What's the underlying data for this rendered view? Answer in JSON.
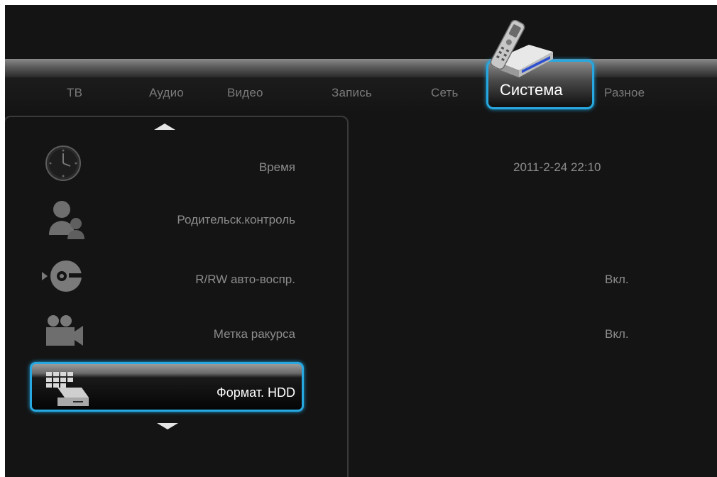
{
  "tabs": [
    {
      "label": "ТВ"
    },
    {
      "label": "Аудио"
    },
    {
      "label": "Видео"
    },
    {
      "label": "Запись"
    },
    {
      "label": "Сеть"
    },
    {
      "label": "Система"
    },
    {
      "label": "Разное"
    }
  ],
  "active_tab": "Система",
  "menu": {
    "items": [
      {
        "label": "Время",
        "icon": "clock-icon",
        "value": "2011-2-24 22:10"
      },
      {
        "label": "Родительск.контроль",
        "icon": "parental-control-icon",
        "value": ""
      },
      {
        "label": "R/RW авто-воспр.",
        "icon": "disc-autoplay-icon",
        "value": "Вкл."
      },
      {
        "label": "Метка ракурса",
        "icon": "camera-angle-icon",
        "value": "Вкл."
      },
      {
        "label": "Формат. HDD",
        "icon": "hdd-format-icon",
        "value": ""
      }
    ],
    "selected_index": 4
  },
  "colors": {
    "accent": "#27a8e0",
    "background": "#141414",
    "text_inactive": "#8c8c8c",
    "text_active": "#ffffff"
  }
}
